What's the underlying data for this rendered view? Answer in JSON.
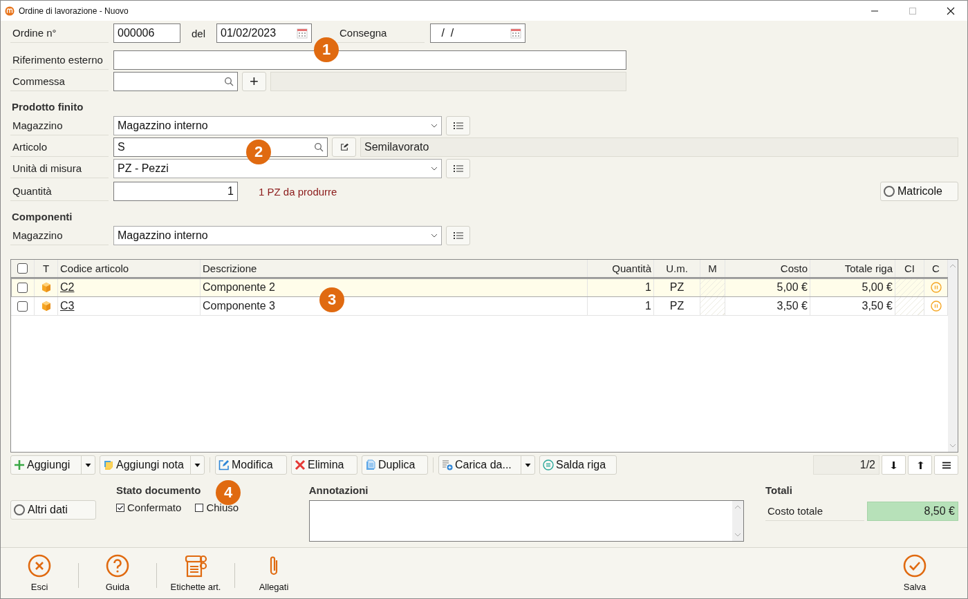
{
  "window": {
    "title": "Ordine di lavorazione - Nuovo"
  },
  "header": {
    "order_label": "Ordine n°",
    "order_number": "000006",
    "date_label": "del",
    "date": "01/02/2023",
    "delivery_label": "Consegna",
    "delivery": " /  /"
  },
  "reference": {
    "label": "Riferimento esterno"
  },
  "job": {
    "label": "Commessa",
    "add": "+"
  },
  "finished_product": {
    "title": "Prodotto finito",
    "warehouse": {
      "label": "Magazzino",
      "value": "Magazzino interno"
    },
    "article": {
      "label": "Articolo",
      "value": "S",
      "description": "Semilavorato"
    },
    "unit": {
      "label": "Unità di misura",
      "value": "PZ - Pezzi"
    },
    "quantity": {
      "label": "Quantità",
      "value": "1",
      "note": "1 PZ da produrre"
    },
    "serials": {
      "label": "Matricole",
      "selected": false
    }
  },
  "components": {
    "title": "Componenti",
    "warehouse": {
      "label": "Magazzino",
      "value": "Magazzino interno"
    }
  },
  "table": {
    "all_checked": false,
    "columns": [
      "T",
      "Codice articolo",
      "Descrizione",
      "Quantità",
      "U.m.",
      "M",
      "Costo",
      "Totale riga",
      "CI",
      "C"
    ],
    "rows": [
      {
        "checked": false,
        "selected": true,
        "code": "C2",
        "description": "Componente 2",
        "quantity": "1",
        "unit": "PZ",
        "cost": "5,00 €",
        "total": "5,00 €"
      },
      {
        "checked": false,
        "selected": false,
        "code": "C3",
        "description": "Componente 3",
        "quantity": "1",
        "unit": "PZ",
        "cost": "3,50 €",
        "total": "3,50 €"
      }
    ]
  },
  "toolbar": [
    {
      "kind": "add",
      "label": "Aggiungi",
      "dropdown": true
    },
    {
      "kind": "note",
      "label": "Aggiungi nota",
      "dropdown": true
    },
    {
      "kind": "edit",
      "label": "Modifica",
      "dropdown": false
    },
    {
      "kind": "delete",
      "label": "Elimina",
      "dropdown": false
    },
    {
      "kind": "duplicate",
      "label": "Duplica",
      "dropdown": false
    },
    {
      "kind": "load",
      "label": "Carica da...",
      "dropdown": true
    },
    {
      "kind": "settle",
      "label": "Salda riga",
      "dropdown": false
    }
  ],
  "pager": "1/2",
  "other_data": {
    "label": "Altri dati",
    "selected": false
  },
  "document_status": {
    "title": "Stato documento",
    "options": [
      {
        "label": "Confermato",
        "checked": true
      },
      {
        "label": "Chiuso",
        "checked": false
      }
    ]
  },
  "notes": {
    "label": "Annotazioni"
  },
  "totals": {
    "title": "Totali",
    "label": "Costo totale",
    "value": "8,50 €"
  },
  "footer": [
    {
      "kind": "exit",
      "label": "Esci"
    },
    {
      "kind": "help",
      "label": "Guida"
    },
    {
      "kind": "labels",
      "label": "Etichette art."
    },
    {
      "kind": "attach",
      "label": "Allegati"
    },
    {
      "kind": "save",
      "label": "Salva"
    }
  ],
  "callouts": [
    "1",
    "2",
    "3",
    "4"
  ]
}
